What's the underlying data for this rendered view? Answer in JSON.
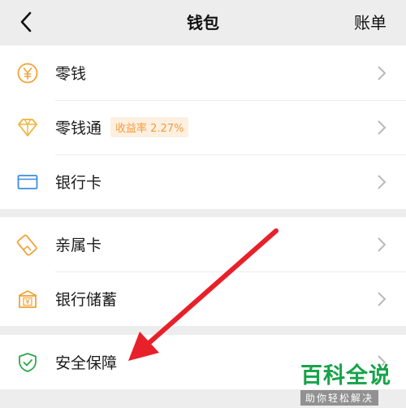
{
  "header": {
    "title": "钱包",
    "right_action": "账单"
  },
  "groups": [
    {
      "items": [
        {
          "label": "零钱",
          "icon": "yuan-coin-icon"
        },
        {
          "label": "零钱通",
          "icon": "diamond-icon",
          "badge": "收益率 2.27%"
        },
        {
          "label": "银行卡",
          "icon": "bank-card-icon"
        }
      ]
    },
    {
      "items": [
        {
          "label": "亲属卡",
          "icon": "family-card-icon"
        },
        {
          "label": "银行储蓄",
          "icon": "bank-savings-icon"
        }
      ]
    },
    {
      "items": [
        {
          "label": "安全保障",
          "icon": "security-shield-icon"
        }
      ]
    }
  ],
  "colors": {
    "background": "#ededed",
    "icon_orange": "#f0a33a",
    "icon_blue": "#3b8de0",
    "icon_green": "#2ca84a",
    "badge_text": "#f39b3c",
    "annotation_arrow": "#e8202a"
  },
  "watermark": {
    "main": "百科全说",
    "sub": "助你轻松解决"
  }
}
